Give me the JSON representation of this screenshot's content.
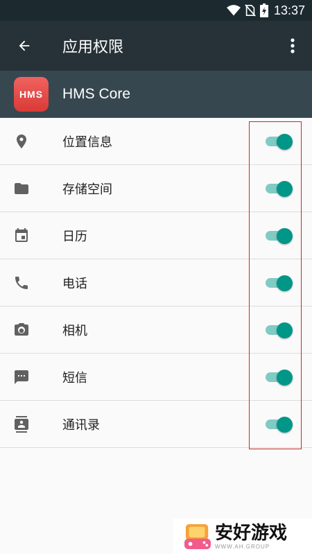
{
  "status_bar": {
    "time": "13:37"
  },
  "toolbar": {
    "title": "应用权限"
  },
  "app": {
    "icon_text": "HMS",
    "name": "HMS Core"
  },
  "permissions": [
    {
      "label": "位置信息",
      "icon": "location-icon",
      "enabled": true
    },
    {
      "label": "存储空间",
      "icon": "folder-icon",
      "enabled": true
    },
    {
      "label": "日历",
      "icon": "calendar-icon",
      "enabled": true
    },
    {
      "label": "电话",
      "icon": "phone-icon",
      "enabled": true
    },
    {
      "label": "相机",
      "icon": "camera-icon",
      "enabled": true
    },
    {
      "label": "短信",
      "icon": "sms-icon",
      "enabled": true
    },
    {
      "label": "通讯录",
      "icon": "contacts-icon",
      "enabled": true
    }
  ],
  "watermark": {
    "title": "安好游戏",
    "subtitle": "WWW.AH.GROUP"
  },
  "colors": {
    "toolbar": "#263238",
    "app_header": "#37474f",
    "switch_on": "#009688",
    "highlight_box": "#c62828"
  }
}
